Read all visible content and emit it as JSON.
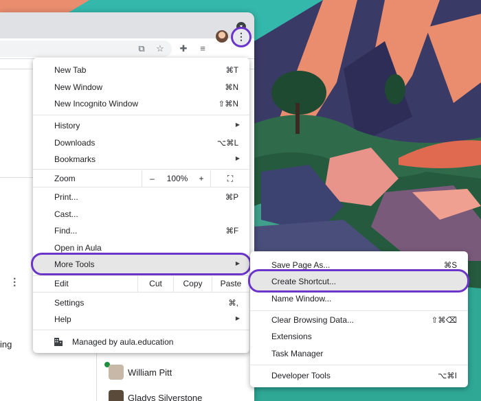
{
  "main_menu": {
    "items": [
      {
        "label": "New Tab",
        "shortcut": "⌘T"
      },
      {
        "label": "New Window",
        "shortcut": "⌘N"
      },
      {
        "label": "New Incognito Window",
        "shortcut": "⇧⌘N"
      },
      {
        "label": "History"
      },
      {
        "label": "Downloads",
        "shortcut": "⌥⌘L"
      },
      {
        "label": "Bookmarks"
      },
      {
        "label": "Print...",
        "shortcut": "⌘P"
      },
      {
        "label": "Cast..."
      },
      {
        "label": "Find...",
        "shortcut": "⌘F"
      },
      {
        "label": "Open in Aula"
      },
      {
        "label": "More Tools"
      },
      {
        "label": "Settings",
        "shortcut": "⌘,"
      },
      {
        "label": "Help"
      }
    ],
    "zoom": {
      "label": "Zoom",
      "minus": "–",
      "value": "100%",
      "plus": "+",
      "fullscreen": "⛶"
    },
    "edit": {
      "label": "Edit",
      "cut": "Cut",
      "copy": "Copy",
      "paste": "Paste"
    },
    "managed": "Managed by aula.education"
  },
  "submenu": {
    "items": [
      {
        "label": "Save Page As...",
        "shortcut": "⌘S"
      },
      {
        "label": "Create Shortcut..."
      },
      {
        "label": "Name Window..."
      },
      {
        "label": "Clear Browsing Data...",
        "shortcut": "⇧⌘⌫"
      },
      {
        "label": "Extensions"
      },
      {
        "label": "Task Manager"
      },
      {
        "label": "Developer Tools",
        "shortcut": "⌥⌘I"
      }
    ]
  },
  "page": {
    "partial_text": "ing",
    "people": [
      "William Pitt",
      "Gladys Silverstone"
    ]
  },
  "toolbar": {
    "menu_glyph": "⋮",
    "tab_dropdown_glyph": "▾"
  },
  "colors": {
    "highlight": "#6a35c8"
  }
}
